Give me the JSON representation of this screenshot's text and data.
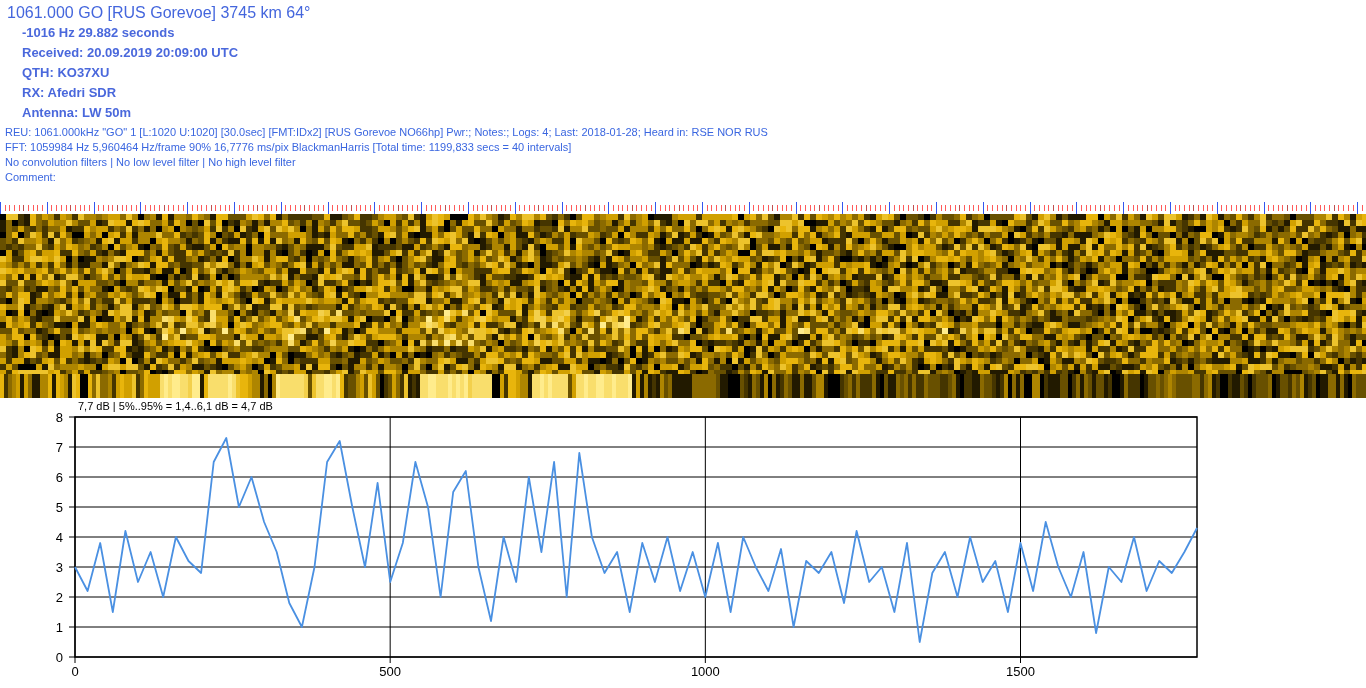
{
  "header": {
    "title": "1061.000 GO [RUS Gorevoe] 3745 km 64°",
    "details": [
      "-1016 Hz 29.882 seconds",
      "Received: 20.09.2019 20:09:00 UTC",
      "QTH: KO37XU",
      "RX: Afedri SDR",
      "Antenna: LW 50m"
    ],
    "info_lines": [
      "REU: 1061.000kHz \"GO\" 1 [L:1020 U:1020] [30.0sec] [FMT:IDx2] [RUS  Gorevoe NO66hp] Pwr:; Notes:; Logs: 4; Last: 2018-01-28; Heard in: RSE NOR RUS",
      "FFT: 1059984 Hz 5,960464 Hz/frame 90% 16,7776 ms/pix BlackmanHarris [Total time: 1199,833 secs = 40 intervals]",
      "No convolution filters | No low level filter | No high level filter",
      "Comment:"
    ]
  },
  "chart": {
    "chart_data": {
      "type": "line",
      "grid": true,
      "title": "7,7 dB | 5%..95% = 1,4..6,1 dB = 4,7 dB",
      "xlim": [
        0,
        1780
      ],
      "ylim": [
        0,
        8
      ],
      "xticks": [
        0,
        500,
        1000,
        1500
      ],
      "yticks": [
        0,
        1,
        2,
        3,
        4,
        5,
        6,
        7,
        8
      ],
      "x": [
        0,
        20,
        40,
        60,
        80,
        100,
        120,
        140,
        160,
        180,
        200,
        220,
        240,
        260,
        280,
        300,
        320,
        340,
        360,
        380,
        400,
        420,
        440,
        460,
        480,
        500,
        520,
        540,
        560,
        580,
        600,
        620,
        640,
        660,
        680,
        700,
        720,
        740,
        760,
        780,
        800,
        820,
        840,
        860,
        880,
        900,
        920,
        940,
        960,
        980,
        1000,
        1020,
        1040,
        1060,
        1080,
        1100,
        1120,
        1140,
        1160,
        1180,
        1200,
        1220,
        1240,
        1260,
        1280,
        1300,
        1320,
        1340,
        1360,
        1380,
        1400,
        1420,
        1440,
        1460,
        1480,
        1500,
        1520,
        1540,
        1560,
        1580,
        1600,
        1620,
        1640,
        1660,
        1680,
        1700,
        1720,
        1740,
        1760,
        1780
      ],
      "series": [
        {
          "color": "#4a90e2",
          "values": [
            3.0,
            2.2,
            3.8,
            1.5,
            4.2,
            2.5,
            3.5,
            2.0,
            4.0,
            3.2,
            2.8,
            6.5,
            7.3,
            5.0,
            6.0,
            4.5,
            3.5,
            1.8,
            1.0,
            3.0,
            6.5,
            7.2,
            5.0,
            3.0,
            5.8,
            2.5,
            3.8,
            6.5,
            5.0,
            2.0,
            5.5,
            6.2,
            3.0,
            1.2,
            4.0,
            2.5,
            6.0,
            3.5,
            6.5,
            2.0,
            6.8,
            4.0,
            2.8,
            3.5,
            1.5,
            3.8,
            2.5,
            4.0,
            2.2,
            3.5,
            2.0,
            3.8,
            1.5,
            4.0,
            3.0,
            2.2,
            3.6,
            1.0,
            3.2,
            2.8,
            3.5,
            1.8,
            4.2,
            2.5,
            3.0,
            1.5,
            3.8,
            0.5,
            2.8,
            3.5,
            2.0,
            4.0,
            2.5,
            3.2,
            1.5,
            3.8,
            2.2,
            4.5,
            3.0,
            2.0,
            3.5,
            0.8,
            3.0,
            2.5,
            4.0,
            2.2,
            3.2,
            2.8,
            3.5,
            4.3
          ]
        }
      ]
    }
  }
}
